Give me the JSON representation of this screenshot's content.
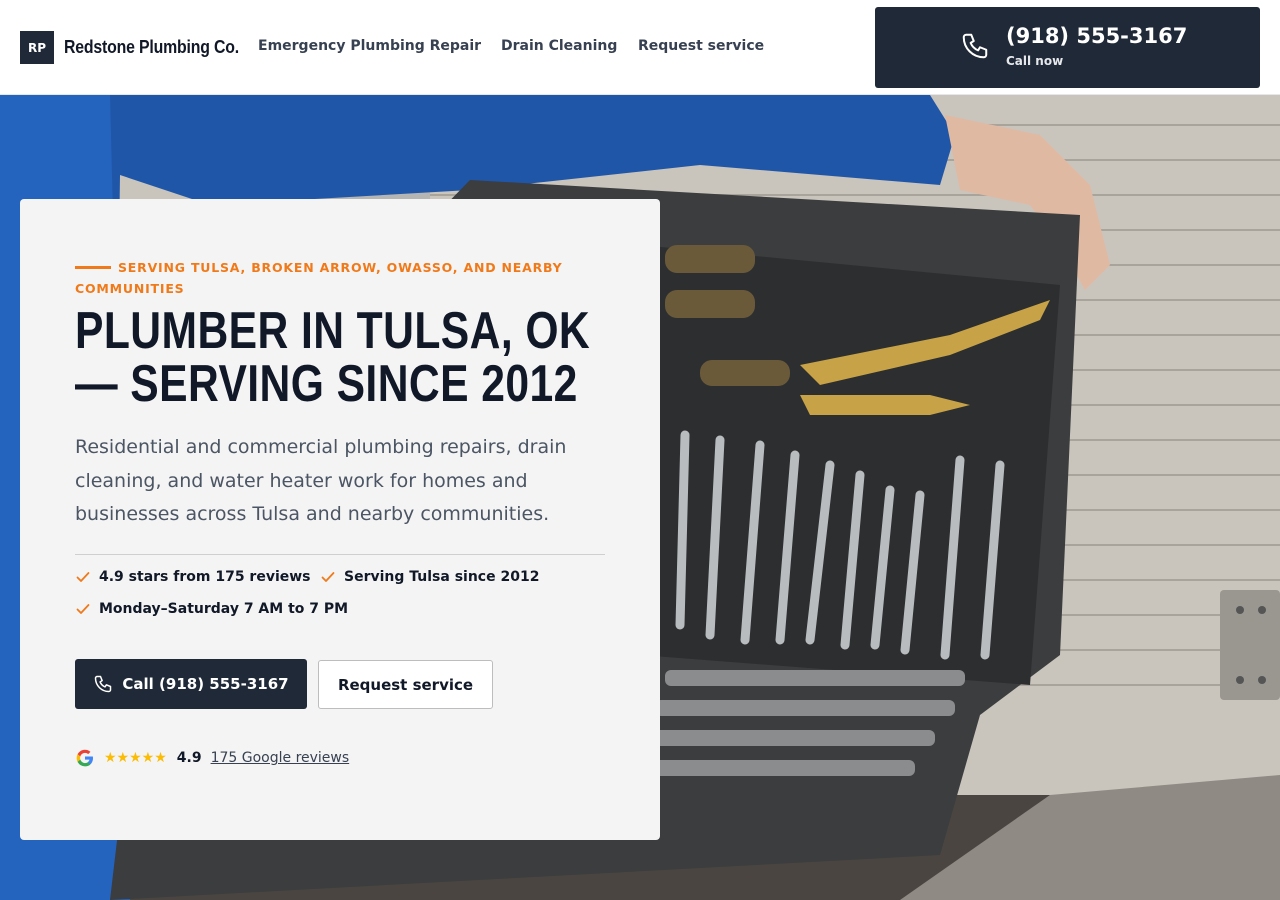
{
  "header": {
    "logo_mark": "RP",
    "logo_text": "Redstone Plumbing Co.",
    "nav": [
      {
        "label": "Emergency Plumbing Repair"
      },
      {
        "label": "Drain Cleaning"
      },
      {
        "label": "Request service"
      }
    ],
    "call_number": "(918) 555-3167",
    "call_sub": "Call now"
  },
  "hero": {
    "eyebrow": "Serving Tulsa, Broken Arrow, Owasso, and nearby communities",
    "title_line1": "Plumber in Tulsa, OK",
    "title_line2": "— Serving Since 2012",
    "description": "Residential and commercial plumbing repairs, drain cleaning, and water heater work for homes and businesses across Tulsa and nearby communities.",
    "features": [
      {
        "label": "4.9 stars from 175 reviews"
      },
      {
        "label": "Serving Tulsa since 2012"
      },
      {
        "label": "Monday–Saturday 7 AM to 7 PM"
      }
    ],
    "call_button": "Call (918) 555-3167",
    "request_button": "Request service",
    "rating": {
      "stars_glyphs": "★★★★★",
      "score": "4.9",
      "reviews_link": "175 Google reviews"
    }
  },
  "colors": {
    "accent": "#f07a1a",
    "dark": "#1f2937",
    "star": "#fbbc05"
  },
  "icons": [
    "phone-icon",
    "check-icon",
    "google-icon",
    "star-icon"
  ]
}
